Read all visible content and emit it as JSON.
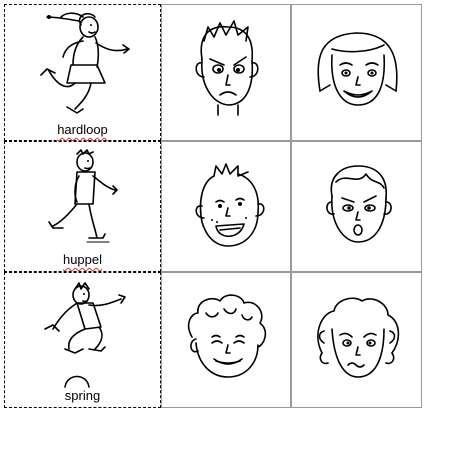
{
  "cards": [
    {
      "label": "hardloop",
      "icon": "running-girl-icon"
    },
    {
      "label": "huppel",
      "icon": "skipping-boy-icon"
    },
    {
      "label": "spring",
      "icon": "jumping-boy-icon"
    }
  ],
  "faces": [
    {
      "icon": "angry-boy-face-icon"
    },
    {
      "icon": "happy-girl-face-icon"
    },
    {
      "icon": "laughing-boy-face-icon"
    },
    {
      "icon": "surprised-boy-face-icon"
    },
    {
      "icon": "smiling-curly-face-icon"
    },
    {
      "icon": "worried-curly-face-icon"
    }
  ]
}
